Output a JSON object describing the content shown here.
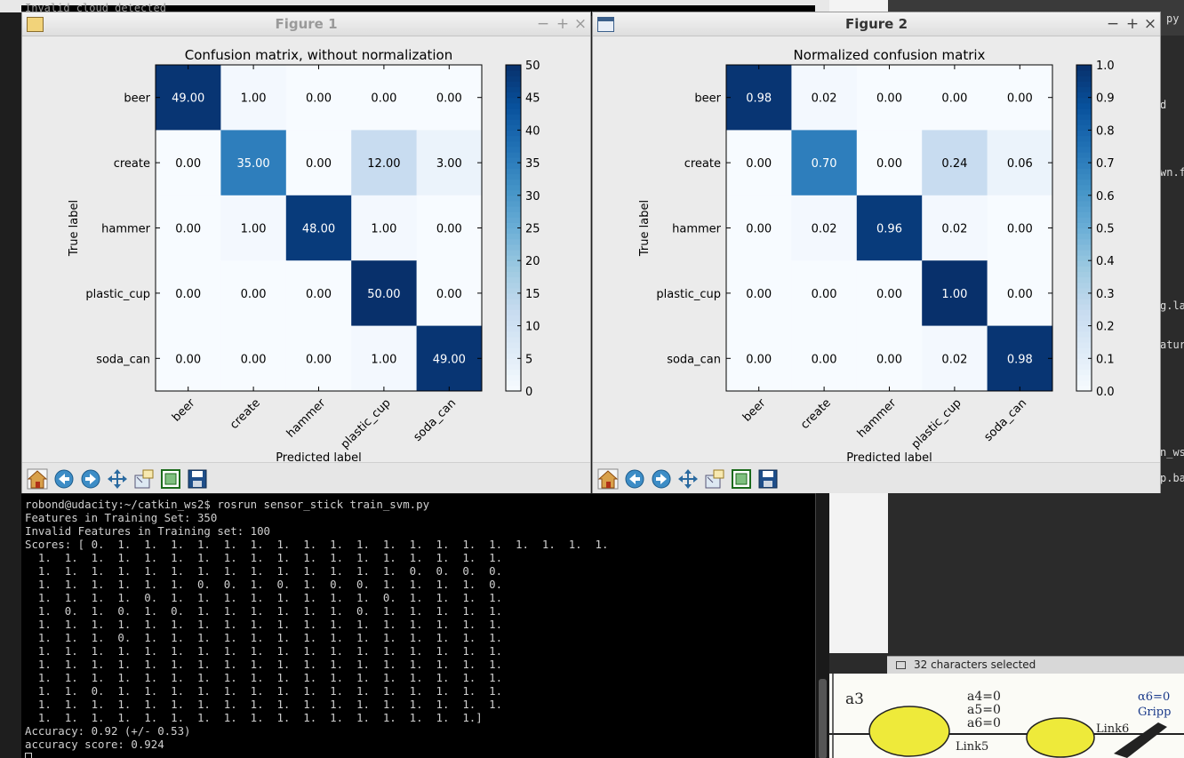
{
  "background": {
    "editor_status": "32 characters selected",
    "editor_snippets": [
      "py",
      "d",
      "wn.f",
      "g.la",
      "atur",
      "n_ws",
      "p.ba"
    ],
    "sketch_labels": [
      "a3",
      "a4=0",
      "a5=0",
      "a6=0",
      "Link5",
      "Link6",
      "Gripp",
      "α6=0"
    ]
  },
  "figure1": {
    "window_title": "Figure 1",
    "chart_data": {
      "type": "heatmap",
      "title": "Confusion matrix, without normalization",
      "xlabel": "Predicted label",
      "ylabel": "True label",
      "x_categories": [
        "beer",
        "create",
        "hammer",
        "plastic_cup",
        "soda_can"
      ],
      "y_categories": [
        "beer",
        "create",
        "hammer",
        "plastic_cup",
        "soda_can"
      ],
      "values": [
        [
          49,
          1,
          0,
          0,
          0
        ],
        [
          0,
          35,
          0,
          12,
          3
        ],
        [
          0,
          1,
          48,
          1,
          0
        ],
        [
          0,
          0,
          0,
          50,
          0
        ],
        [
          0,
          0,
          0,
          1,
          49
        ]
      ],
      "cell_labels": [
        [
          "49.00",
          "1.00",
          "0.00",
          "0.00",
          "0.00"
        ],
        [
          "0.00",
          "35.00",
          "0.00",
          "12.00",
          "3.00"
        ],
        [
          "0.00",
          "1.00",
          "48.00",
          "1.00",
          "0.00"
        ],
        [
          "0.00",
          "0.00",
          "0.00",
          "50.00",
          "0.00"
        ],
        [
          "0.00",
          "0.00",
          "0.00",
          "1.00",
          "49.00"
        ]
      ],
      "vmin": 0,
      "vmax": 50,
      "colormap": "Blues",
      "colorbar_ticks": [
        "0",
        "5",
        "10",
        "15",
        "20",
        "25",
        "30",
        "35",
        "40",
        "45",
        "50"
      ]
    }
  },
  "figure2": {
    "window_title": "Figure 2",
    "chart_data": {
      "type": "heatmap",
      "title": "Normalized confusion matrix",
      "xlabel": "Predicted label",
      "ylabel": "True label",
      "x_categories": [
        "beer",
        "create",
        "hammer",
        "plastic_cup",
        "soda_can"
      ],
      "y_categories": [
        "beer",
        "create",
        "hammer",
        "plastic_cup",
        "soda_can"
      ],
      "values": [
        [
          0.98,
          0.02,
          0,
          0,
          0
        ],
        [
          0,
          0.7,
          0,
          0.24,
          0.06
        ],
        [
          0,
          0.02,
          0.96,
          0.02,
          0
        ],
        [
          0,
          0,
          0,
          1.0,
          0
        ],
        [
          0,
          0,
          0,
          0.02,
          0.98
        ]
      ],
      "cell_labels": [
        [
          "0.98",
          "0.02",
          "0.00",
          "0.00",
          "0.00"
        ],
        [
          "0.00",
          "0.70",
          "0.00",
          "0.24",
          "0.06"
        ],
        [
          "0.00",
          "0.02",
          "0.96",
          "0.02",
          "0.00"
        ],
        [
          "0.00",
          "0.00",
          "0.00",
          "1.00",
          "0.00"
        ],
        [
          "0.00",
          "0.00",
          "0.00",
          "0.02",
          "0.98"
        ]
      ],
      "vmin": 0,
      "vmax": 1,
      "colormap": "Blues",
      "colorbar_ticks": [
        "0.0",
        "0.1",
        "0.2",
        "0.3",
        "0.4",
        "0.5",
        "0.6",
        "0.7",
        "0.8",
        "0.9",
        "1.0"
      ]
    }
  },
  "toolbar_icons": [
    "home-icon",
    "back-icon",
    "forward-icon",
    "pan-icon",
    "zoom-icon",
    "subplots-icon",
    "save-icon"
  ],
  "terminal": {
    "top_fragment": "Invalid cloud detected",
    "lines": [
      "robond@udacity:~/catkin_ws2$ rosrun sensor_stick train_svm.py",
      "Features in Training Set: 350",
      "Invalid Features in Training set: 100",
      "Scores: [ 0.  1.  1.  1.  1.  1.  1.  1.  1.  1.  1.  1.  1.  1.  1.  1.  1.  1.  1.  1.",
      "  1.  1.  1.  1.  1.  1.  1.  1.  1.  1.  1.  1.  1.  1.  1.  1.  1.  1.",
      "  1.  1.  1.  1.  1.  1.  1.  1.  1.  1.  1.  1.  1.  1.  0.  0.  0.  0.",
      "  1.  1.  1.  1.  1.  1.  0.  0.  1.  0.  1.  0.  0.  1.  1.  1.  1.  0.",
      "  1.  1.  1.  1.  0.  1.  1.  1.  1.  1.  1.  1.  1.  0.  1.  1.  1.  1.",
      "  1.  0.  1.  0.  1.  0.  1.  1.  1.  1.  1.  1.  0.  1.  1.  1.  1.  1.",
      "  1.  1.  1.  1.  1.  1.  1.  1.  1.  1.  1.  1.  1.  1.  1.  1.  1.  1.",
      "  1.  1.  1.  0.  1.  1.  1.  1.  1.  1.  1.  1.  1.  1.  1.  1.  1.  1.",
      "  1.  1.  1.  1.  1.  1.  1.  1.  1.  1.  1.  1.  1.  1.  1.  1.  1.  1.",
      "  1.  1.  1.  1.  1.  1.  1.  1.  1.  1.  1.  1.  1.  1.  1.  1.  1.  1.",
      "  1.  1.  1.  1.  1.  1.  1.  1.  1.  1.  1.  1.  1.  1.  1.  1.  1.  1.",
      "  1.  1.  0.  1.  1.  1.  1.  1.  1.  1.  1.  1.  1.  1.  1.  1.  1.  1.",
      "  1.  1.  1.  1.  1.  1.  1.  1.  1.  1.  1.  1.  1.  1.  1.  1.  1.  1.",
      "  1.  1.  1.  1.  1.  1.  1.  1.  1.  1.  1.  1.  1.  1.  1.  1.  1.]",
      "Accuracy: 0.92 (+/- 0.53)",
      "accuracy score: 0.924"
    ]
  }
}
